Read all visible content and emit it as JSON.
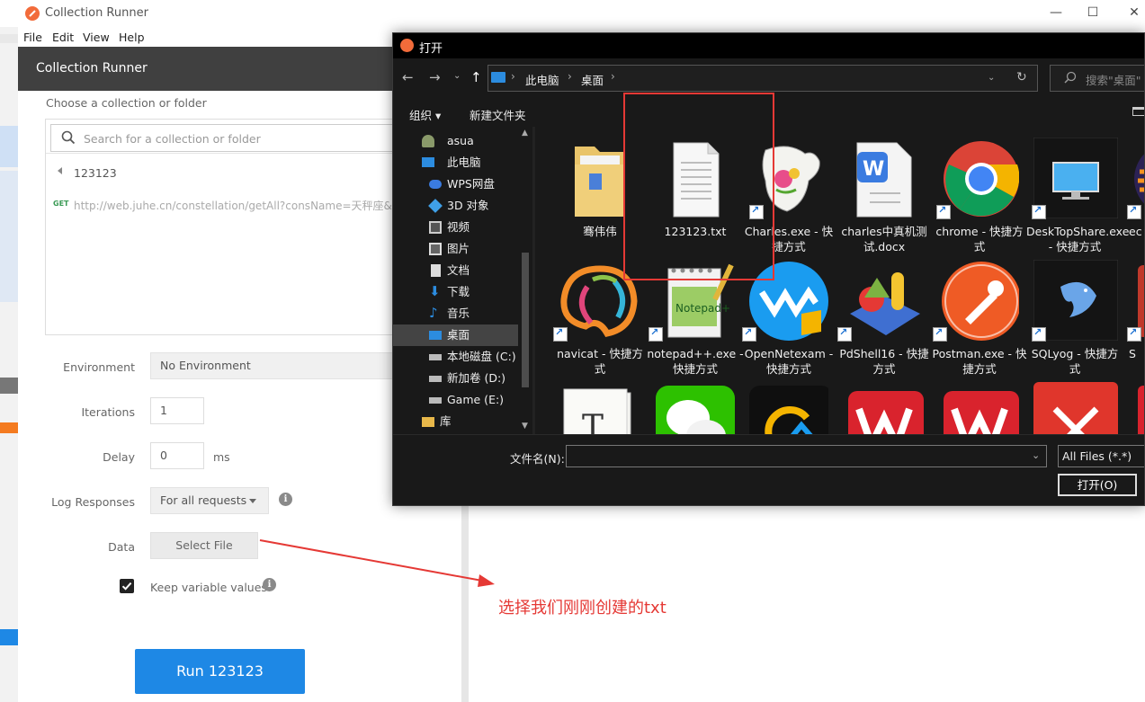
{
  "app": {
    "window_title": "Collection Runner",
    "menu": [
      "File",
      "Edit",
      "View",
      "Help"
    ],
    "window_controls": [
      "—",
      "☐",
      "✕"
    ]
  },
  "runner": {
    "header_title": "Collection Runner",
    "choose_label": "Choose a collection or folder",
    "search_placeholder": "Search for a collection or folder",
    "collection_name": "123123",
    "request_method": "GET",
    "request_url": "http://web.juhe.cn/constellation/getAll?consName=天秤座&type",
    "environment_label": "Environment",
    "environment_value": "No Environment",
    "iterations_label": "Iterations",
    "iterations_value": "1",
    "delay_label": "Delay",
    "delay_value": "0",
    "delay_unit": "ms",
    "log_label": "Log Responses",
    "log_value": "For all requests",
    "data_label": "Data",
    "select_file_label": "Select File",
    "keep_label": "Keep variable values",
    "keep_checked": true,
    "run_label": "Run 123123"
  },
  "annotation": {
    "text": "选择我们刚刚创建的txt",
    "color": "#e53935"
  },
  "dialog": {
    "title": "打开",
    "breadcrumb": [
      "此电脑",
      "桌面"
    ],
    "search_placeholder": "搜索\"桌面\"",
    "organize_label": "组织 ▾",
    "new_folder_label": "新建文件夹",
    "nav_items": [
      {
        "label": "asua",
        "icon": "user-icon"
      },
      {
        "label": "此电脑",
        "icon": "computer-icon"
      },
      {
        "label": "WPS网盘",
        "icon": "cloud-icon"
      },
      {
        "label": "3D 对象",
        "icon": "cube-icon"
      },
      {
        "label": "视频",
        "icon": "video-icon"
      },
      {
        "label": "图片",
        "icon": "picture-icon"
      },
      {
        "label": "文档",
        "icon": "document-icon"
      },
      {
        "label": "下载",
        "icon": "download-icon"
      },
      {
        "label": "音乐",
        "icon": "music-icon"
      },
      {
        "label": "桌面",
        "icon": "desktop-icon",
        "selected": true
      },
      {
        "label": "本地磁盘 (C:)",
        "icon": "drive-icon"
      },
      {
        "label": "新加卷 (D:)",
        "icon": "drive-icon"
      },
      {
        "label": "Game (E:)",
        "icon": "drive-icon"
      },
      {
        "label": "库",
        "icon": "library-icon"
      }
    ],
    "files_row1": [
      {
        "label": "骞伟伟",
        "icon": "folder-icon"
      },
      {
        "label": "123123.txt",
        "icon": "text-file-icon"
      },
      {
        "label": "Charles.exe - 快捷方式",
        "icon": "charles-icon"
      },
      {
        "label": "charles中真机测试.docx",
        "icon": "wps-doc-icon"
      },
      {
        "label": "chrome - 快捷方式",
        "icon": "chrome-icon"
      },
      {
        "label": "DeskTopShare.exe - 快捷方式",
        "icon": "monitor-icon"
      },
      {
        "label": "ec",
        "icon": "eclipse-icon"
      }
    ],
    "files_row2": [
      {
        "label": "navicat - 快捷方式",
        "icon": "navicat-icon"
      },
      {
        "label": "notepad++.exe - 快捷方式",
        "icon": "notepad-icon"
      },
      {
        "label": "OpenNetexam - 快捷方式",
        "icon": "opennetexam-icon"
      },
      {
        "label": "PdShell16 - 快捷方式",
        "icon": "pdshell-icon"
      },
      {
        "label": "Postman.exe - 快捷方式",
        "icon": "postman-icon"
      },
      {
        "label": "SQLyog - 快捷方式",
        "icon": "sqlyog-icon"
      },
      {
        "label": "S",
        "icon": "app-icon"
      }
    ],
    "filename_label": "文件名(N):",
    "filename_value": "",
    "filter_value": "All Files (*.*)",
    "open_label": "打开(O)"
  }
}
